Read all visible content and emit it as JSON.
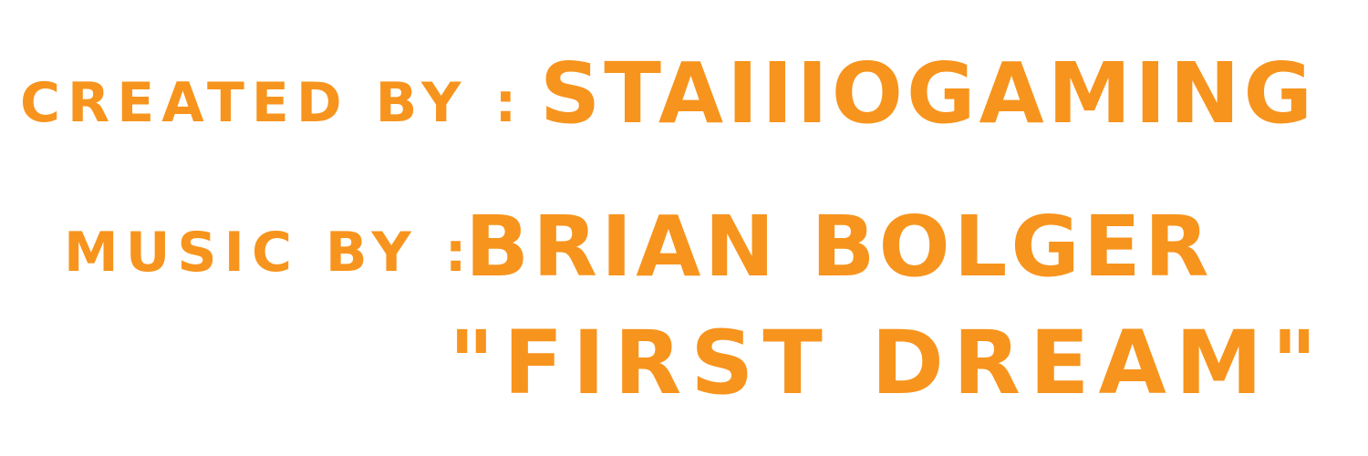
{
  "colors": {
    "text": "#f7941d",
    "background": "#ffffff"
  },
  "credits": {
    "created_by_label": "CREATED BY :",
    "creator": "STAIIIOGAMING",
    "music_by_label": "MUSIC BY :",
    "composer": "BRIAN BOLGER",
    "song_title": "\"FIRST DREAM\""
  }
}
